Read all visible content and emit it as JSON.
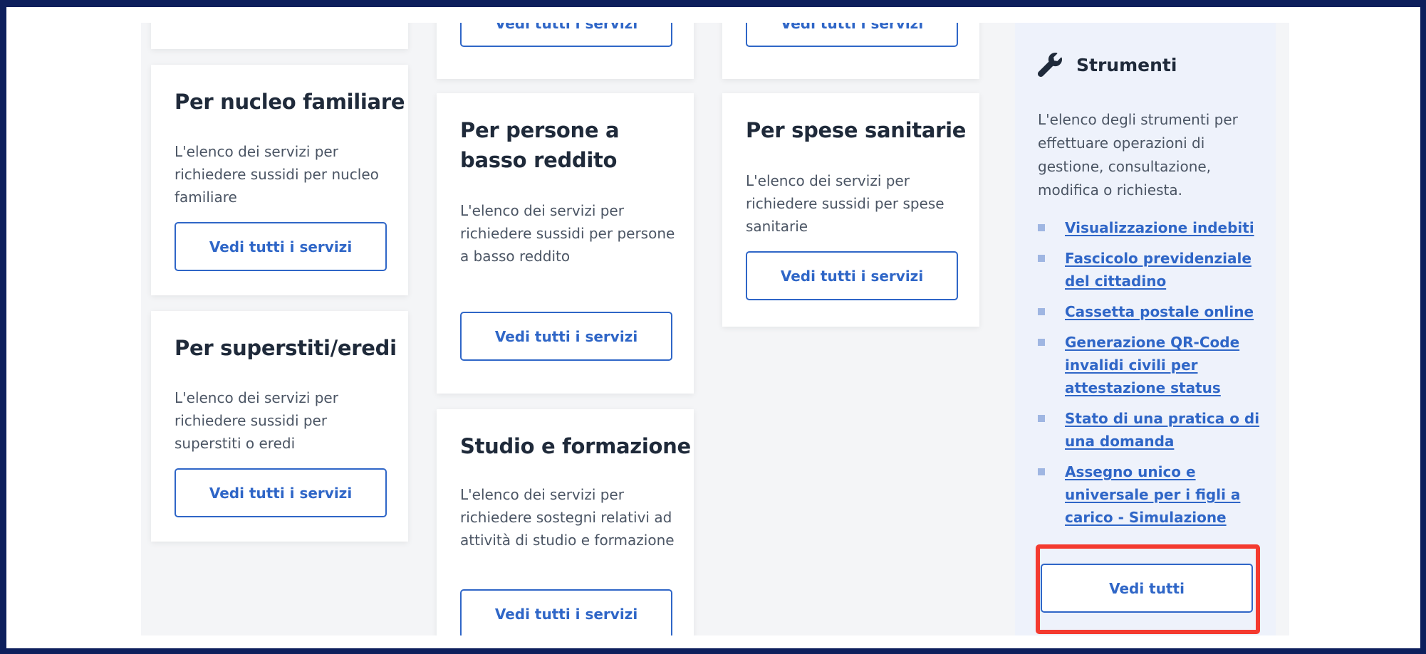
{
  "cards": {
    "top_btn_1": "Vedi tutti i servizi",
    "top_btn_2": "Vedi tutti i servizi",
    "nucleo": {
      "title": "Per nucleo familiare",
      "desc": "L'elenco dei servizi per richiedere sussidi per nucleo familiare",
      "button": "Vedi tutti i servizi"
    },
    "superstiti": {
      "title": "Per superstiti/eredi",
      "desc": "L'elenco dei servizi per richiedere sussidi per superstiti o eredi",
      "button": "Vedi tutti i servizi"
    },
    "basso_reddito": {
      "title": "Per persone a basso reddito",
      "desc": "L'elenco dei servizi per richiedere sussidi per persone a basso reddito",
      "button": "Vedi tutti i servizi"
    },
    "studio": {
      "title": "Studio e formazione",
      "desc": "L'elenco dei servizi per richiedere sostegni relativi ad attività di studio e formazione",
      "button": "Vedi tutti i servizi"
    },
    "sanitarie": {
      "title": "Per spese sanitarie",
      "desc": "L'elenco dei servizi per richiedere sussidi per spese sanitarie",
      "button": "Vedi tutti i servizi"
    }
  },
  "sidebar": {
    "title": "Strumenti",
    "icon": "wrench-icon",
    "description": "L'elenco degli strumenti per effettuare operazioni di gestione, consultazione, modifica o richiesta.",
    "links": [
      "Visualizzazione indebiti",
      "Fascicolo previdenziale del cittadino",
      "Cassetta postale online",
      "Generazione QR-Code invalidi civili per attestazione status",
      "Stato di una pratica o di una domanda",
      "Assegno unico e universale per i figli a carico - Simulazione"
    ],
    "all_button": "Vedi tutti"
  },
  "colors": {
    "accent": "#2f66c7",
    "highlight": "#f43a2f",
    "frame": "#0d1f5c"
  }
}
